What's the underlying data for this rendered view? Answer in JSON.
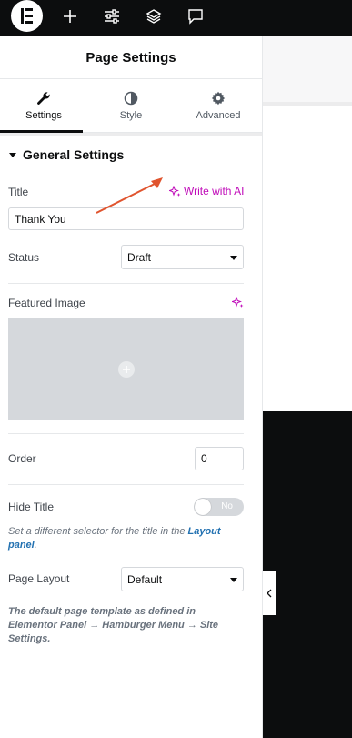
{
  "panel": {
    "title": "Page Settings",
    "tabs": [
      {
        "label": "Settings",
        "icon": "wrench-icon",
        "active": true
      },
      {
        "label": "Style",
        "icon": "half-circle-icon",
        "active": false
      },
      {
        "label": "Advanced",
        "icon": "gear-icon",
        "active": false
      }
    ],
    "section_title": "General Settings"
  },
  "fields": {
    "title_label": "Title",
    "write_with_ai": "Write with AI",
    "title_value": "Thank You",
    "status_label": "Status",
    "status_value": "Draft",
    "featured_image_label": "Featured Image",
    "order_label": "Order",
    "order_value": "0",
    "hide_title_label": "Hide Title",
    "hide_title_toggle": "No",
    "hide_title_note_prefix": "Set a different selector for the title in the ",
    "hide_title_note_link": "Layout panel",
    "hide_title_note_suffix": ".",
    "page_layout_label": "Page Layout",
    "page_layout_value": "Default",
    "page_layout_note": "The default page template as defined in Elementor Panel → Hamburger Menu → Site Settings."
  },
  "colors": {
    "topbar": "#0c0d0e",
    "ai_accent": "#c00bb9",
    "link": "#2271b1",
    "annotation_arrow": "#e0542e"
  },
  "toolbar_icons": [
    "elementor-logo-icon",
    "plus-icon",
    "sliders-icon",
    "layers-icon",
    "comment-icon"
  ]
}
